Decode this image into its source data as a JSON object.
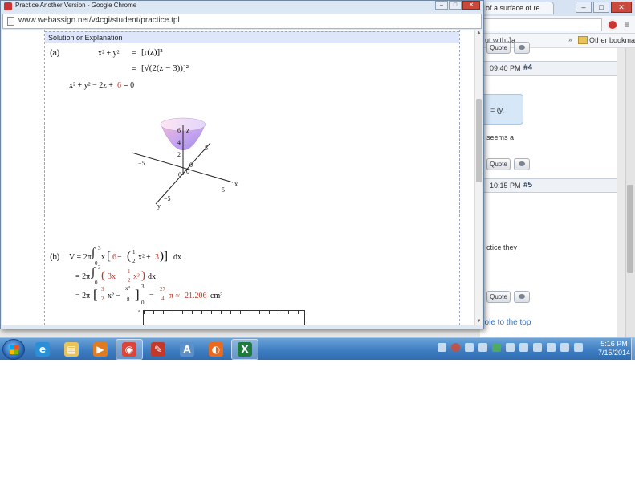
{
  "popup": {
    "title": "Practice Another Version - Google Chrome",
    "url": "www.webassign.net/v4cgi/student/practice.tpl",
    "controls": {
      "minimize": "–",
      "maximize": "□",
      "close": "✕"
    },
    "solution_header": "Solution or Explanation"
  },
  "solution": {
    "part_a": {
      "label": "(a)",
      "eq1_lhs": "x² + y²",
      "eq1_rhs": "[r(z)]²",
      "eq2_rhs": "[√(2(z − 3))]²",
      "eq3_lhs": "x² + y² − 2z +",
      "eq3_const": "6",
      "eq3_rhs": "= 0"
    },
    "plot": {
      "z_label": "z",
      "x_label": "x",
      "y_label": "y",
      "z_ticks": [
        "6",
        "4",
        "2",
        "0"
      ],
      "tick_neg5_left": "−5",
      "tick_5_upper": "5",
      "tick_5_x": "5",
      "tick_neg5_y": "−5",
      "origin": "0",
      "origin2": "0"
    },
    "part_b": {
      "label": "(b)",
      "line1_V": "V = 2π",
      "line1_upper": "3",
      "line1_lower": "0",
      "line1_body": "x",
      "line1_six": "6",
      "line1_minus": " − ",
      "line1_half_num": "1",
      "line1_half_den": "2",
      "line1_x2": "x²",
      "line1_plus": " + ",
      "line1_three": "3",
      "line1_dx": "dx",
      "line2_prefix": "= 2π",
      "line2_upper": "3",
      "line2_lower": "0",
      "line2_term1": "3x",
      "line2_minus": " − ",
      "line2_frac_num": "1",
      "line2_frac_den": "2",
      "line2_x3": "x³",
      "line2_dx": "dx",
      "line3_prefix": "= 2π",
      "line3_frac1_num": "3",
      "line3_frac1_den": "2",
      "line3_x2": "x²",
      "line3_minus": " − ",
      "line3_frac2_num": "x⁴",
      "line3_frac2_den": "8",
      "line3_upper": "3",
      "line3_lower": "0",
      "line3_eq": "=",
      "line3_result_num": "27",
      "line3_result_den": "4",
      "line3_pi": "π ≈",
      "line3_value": "21.206",
      "line3_unit": "cm³",
      "mini_box_label": "a"
    }
  },
  "background_browser": {
    "active_tab": "of a surface of re",
    "controls": {
      "minimize": "–",
      "maximize": "□",
      "close": "✕"
    },
    "bookmark_left": "ut with Ja...",
    "bookmark_arrow": "»",
    "other_bookmarks": "Other bookmarks",
    "menu_glyph": "≡",
    "quote_label": "Quote",
    "posts": [
      {
        "time": "09:40 PM",
        "num": "#4"
      },
      {
        "time": "10:15 PM",
        "num": "#5"
      }
    ],
    "blue_box_text": "= (y,",
    "seems_text": "seems a",
    "practice_text": "ctice they",
    "back_to_top": "hole to the top"
  },
  "taskbar": {
    "time": "5:16 PM",
    "date": "7/15/2014",
    "apps": [
      {
        "icon": "internet-explorer-icon",
        "glyph": "e",
        "color": "#2a8fd6",
        "active": false
      },
      {
        "icon": "file-explorer-icon",
        "glyph": "▤",
        "color": "#e8c35c",
        "active": false
      },
      {
        "icon": "media-player-icon",
        "glyph": "▶",
        "color": "#e07b1f",
        "active": false
      },
      {
        "icon": "chrome-icon",
        "glyph": "◉",
        "color": "#d9453a",
        "active": true
      },
      {
        "icon": "app-red-icon",
        "glyph": "✎",
        "color": "#c0392b",
        "active": false
      },
      {
        "icon": "app-a-icon",
        "glyph": "A",
        "color": "#5a8fc7",
        "active": false
      },
      {
        "icon": "firefox-icon",
        "glyph": "◐",
        "color": "#e86a1f",
        "active": false
      },
      {
        "icon": "excel-icon",
        "glyph": "X",
        "color": "#1f7a3d",
        "active": true
      }
    ]
  }
}
